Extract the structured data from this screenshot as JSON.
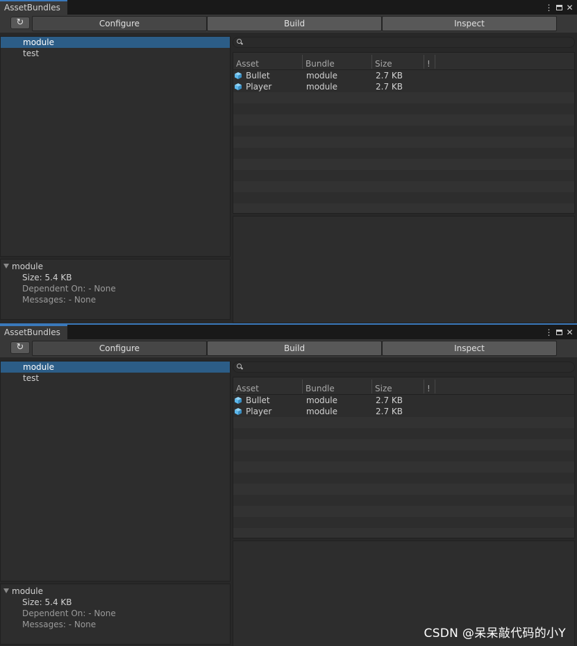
{
  "windows": [
    {
      "tab_title": "AssetBundles",
      "refresh_icon": "↻",
      "modes": [
        {
          "label": "Configure"
        },
        {
          "label": "Build"
        },
        {
          "label": "Inspect"
        }
      ],
      "bundles": [
        {
          "label": "module"
        },
        {
          "label": "test"
        }
      ],
      "details": {
        "name": "module",
        "size": "Size: 5.4 KB",
        "dependent": "Dependent On: - None",
        "messages": "Messages: - None"
      },
      "columns": {
        "asset": "Asset",
        "bundle": "Bundle",
        "size": "Size",
        "warn": "!"
      },
      "rows": [
        {
          "asset": "Bullet",
          "bundle": "module",
          "size": "2.7 KB"
        },
        {
          "asset": "Player",
          "bundle": "module",
          "size": "2.7 KB"
        }
      ]
    },
    {
      "tab_title": "AssetBundles",
      "refresh_icon": "↻",
      "modes": [
        {
          "label": "Configure"
        },
        {
          "label": "Build"
        },
        {
          "label": "Inspect"
        }
      ],
      "bundles": [
        {
          "label": "module"
        },
        {
          "label": "test"
        }
      ],
      "details": {
        "name": "module",
        "size": "Size: 5.4 KB",
        "dependent": "Dependent On: - None",
        "messages": "Messages: - None"
      },
      "columns": {
        "asset": "Asset",
        "bundle": "Bundle",
        "size": "Size",
        "warn": "!"
      },
      "rows": [
        {
          "asset": "Bullet",
          "bundle": "module",
          "size": "2.7 KB"
        },
        {
          "asset": "Player",
          "bundle": "module",
          "size": "2.7 KB"
        }
      ]
    }
  ],
  "watermark": "CSDN @呆呆敲代码的小Y",
  "colors": {
    "selection": "#2c5d87",
    "accent": "#3a79bb",
    "cube_icon": "#5cb8ec"
  }
}
